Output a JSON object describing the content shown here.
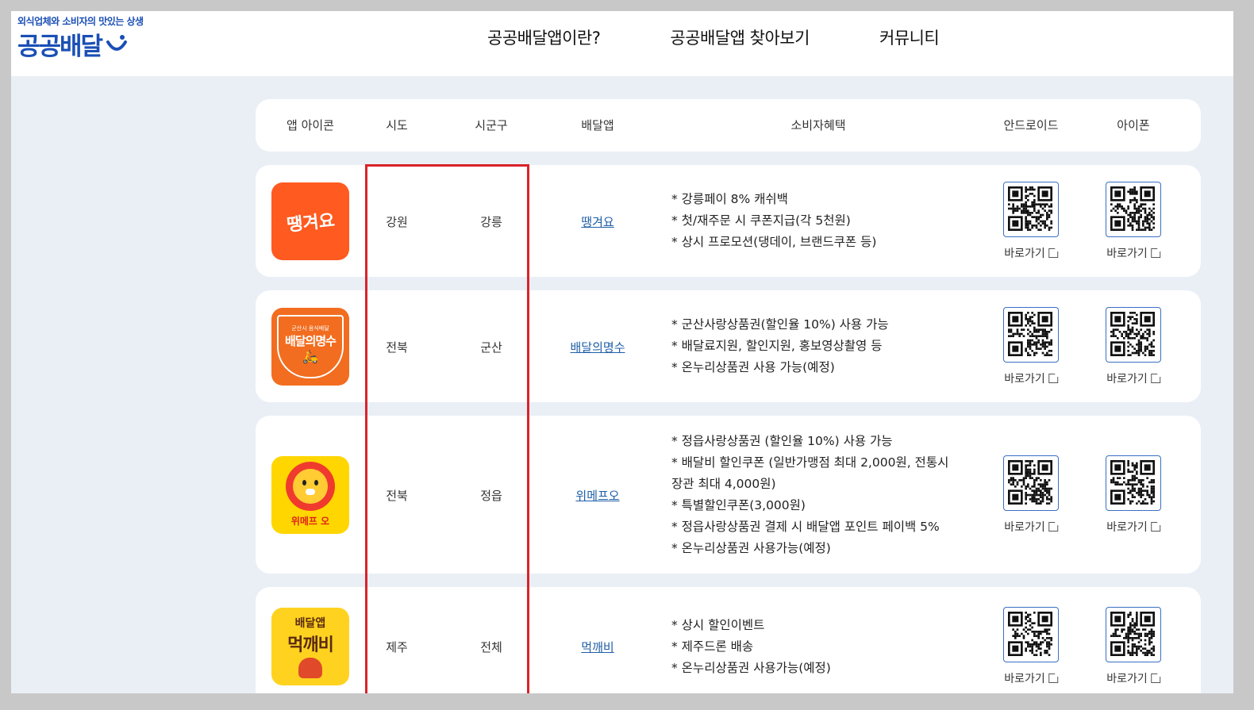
{
  "logo": {
    "tagline": "외식업체와 소비자의 맛있는 상생",
    "brand": "공공배달"
  },
  "nav": [
    "공공배달앱이란?",
    "공공배달앱 찾아보기",
    "커뮤니티"
  ],
  "columns": [
    "앱 아이콘",
    "시도",
    "시군구",
    "배달앱",
    "소비자혜택",
    "안드로이드",
    "아이폰"
  ],
  "goto_label": "바로가기",
  "rows": [
    {
      "icon": "ddaenggyeoyo-icon",
      "icon_text": "땡겨요",
      "icon_color": "#ff5a1f",
      "sido": "강원",
      "sigungu": "강릉",
      "app": "땡겨요",
      "benefits": [
        "* 강릉페이 8% 캐쉬백",
        "* 첫/재주문 시 쿠폰지급(각 5천원)",
        "* 상시 프로모션(댕데이, 브랜드쿠폰 등)"
      ]
    },
    {
      "icon": "baedal-myeongsu-icon",
      "icon_text": "배달의명수",
      "icon_sub": "군산시 음식배달",
      "icon_color": "#f26d1f",
      "sido": "전북",
      "sigungu": "군산",
      "app": "배달의명수",
      "benefits": [
        "* 군산사랑상품권(할인율 10%) 사용 가능",
        "* 배달료지원, 할인지원, 홍보영상촬영 등",
        "* 온누리상품권 사용 가능(예정)"
      ]
    },
    {
      "icon": "wemakeprice-o-icon",
      "icon_text": "위메프 오",
      "icon_color": "#ffd600",
      "sido": "전북",
      "sigungu": "정읍",
      "app": "위메프오",
      "benefits": [
        "* 정읍사랑상품권 (할인율 10%) 사용 가능",
        "* 배달비 할인쿠폰 (일반가맹점 최대 2,000원, 전통시",
        "장관 최대 4,000원)",
        "* 특별할인쿠폰(3,000원)",
        "* 정읍사랑상품권 결제 시 배달앱 포인트 페이백 5%",
        "* 온누리상품권 사용가능(예정)"
      ]
    },
    {
      "icon": "meokkaebi-icon",
      "icon_text": "먹깨비",
      "icon_sub": "배달앱",
      "icon_color": "#ffd21f",
      "sido": "제주",
      "sigungu": "전체",
      "app": "먹깨비",
      "benefits": [
        "* 상시 할인이벤트",
        "* 제주드론 배송",
        "* 온누리상품권 사용가능(예정)"
      ]
    }
  ],
  "colors": {
    "brand": "#1a4fb5",
    "link": "#1f5ea8",
    "highlight": "#d9232a",
    "page_bg": "#eaeff6"
  }
}
